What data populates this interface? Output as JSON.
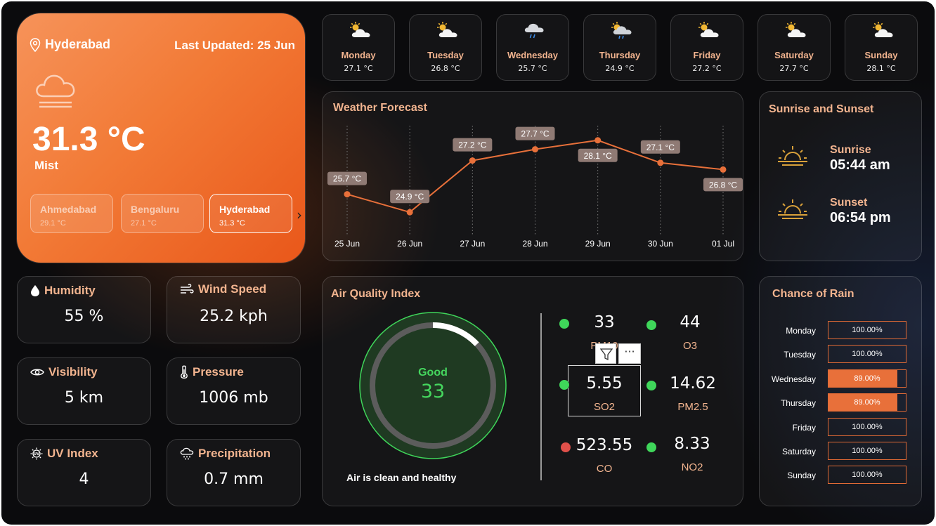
{
  "location": {
    "city": "Hyderabad",
    "last_updated": "Last Updated: 25 Jun",
    "temperature": "31.3 °C",
    "condition": "Mist",
    "icon": "cloud-mist-icon"
  },
  "cities": [
    {
      "name": "Ahmedabad",
      "temp": "29.1 °C",
      "active": false
    },
    {
      "name": "Bengaluru",
      "temp": "27.1 °C",
      "active": false
    },
    {
      "name": "Hyderabad",
      "temp": "31.3 °C",
      "active": true
    }
  ],
  "stats": {
    "humidity": {
      "label": "Humidity",
      "value": "55 %",
      "icon": "droplet-icon"
    },
    "wind": {
      "label": "Wind Speed",
      "value": "25.2 kph",
      "icon": "wind-icon"
    },
    "visibility": {
      "label": "Visibility",
      "value": "5 km",
      "icon": "eye-icon"
    },
    "pressure": {
      "label": "Pressure",
      "value": "1006 mb",
      "icon": "thermometer-icon"
    },
    "uv": {
      "label": "UV Index",
      "value": "4",
      "icon": "uv-sun-icon"
    },
    "precipitation": {
      "label": "Precipitation",
      "value": "0.7 mm",
      "icon": "rain-cloud-icon"
    }
  },
  "daily": [
    {
      "day": "Monday",
      "temp": "27.1 °C",
      "icon": "partly-cloudy-icon"
    },
    {
      "day": "Tuesday",
      "temp": "26.8 °C",
      "icon": "partly-cloudy-icon"
    },
    {
      "day": "Wednesday",
      "temp": "25.7 °C",
      "icon": "cloud-rain-icon"
    },
    {
      "day": "Thursday",
      "temp": "24.9 °C",
      "icon": "partly-cloudy-rain-icon"
    },
    {
      "day": "Friday",
      "temp": "27.2 °C",
      "icon": "partly-cloudy-icon"
    },
    {
      "day": "Saturday",
      "temp": "27.7 °C",
      "icon": "partly-cloudy-icon"
    },
    {
      "day": "Sunday",
      "temp": "28.1 °C",
      "icon": "partly-cloudy-icon"
    }
  ],
  "forecast": {
    "title": "Weather Forecast"
  },
  "chart_data": {
    "type": "line",
    "title": "Weather Forecast",
    "x": [
      "25 Jun",
      "26 Jun",
      "27 Jun",
      "28 Jun",
      "29 Jun",
      "30 Jun",
      "01 Jul"
    ],
    "series": [
      {
        "values": [
          25.7,
          24.9,
          27.2,
          27.7,
          28.1,
          27.1,
          26.8
        ],
        "labels": [
          "25.7 °C",
          "24.9 °C",
          "27.2 °C",
          "27.7 °C",
          "28.1 °C",
          "27.1 °C",
          "26.8 °C"
        ]
      }
    ],
    "ylim": [
      24.0,
      29.0
    ],
    "color": "#e8703a",
    "grid": "vertical dotted"
  },
  "sun": {
    "title": "Sunrise and Sunset",
    "sunrise_label": "Sunrise",
    "sunrise_time": "05:44 am",
    "sunset_label": "Sunset",
    "sunset_time": "06:54 pm",
    "icon_color": "#d9a13a"
  },
  "aqi": {
    "title": "Air Quality Index",
    "status": "Good",
    "value": "33",
    "level": 0.13,
    "message": "Air is clean and healthy",
    "pollutants": [
      {
        "name": "PM10",
        "value": "33",
        "color": "#3fd65a"
      },
      {
        "name": "O3",
        "value": "44",
        "color": "#3fd65a"
      },
      {
        "name": "SO2",
        "value": "5.55",
        "color": "#3fd65a"
      },
      {
        "name": "PM2.5",
        "value": "14.62",
        "color": "#3fd65a"
      },
      {
        "name": "CO",
        "value": "523.55",
        "color": "#e0504a"
      },
      {
        "name": "NO2",
        "value": "8.33",
        "color": "#3fd65a"
      }
    ]
  },
  "rain": {
    "title": "Chance of Rain",
    "rows": [
      {
        "day": "Monday",
        "pct": "100.00%",
        "fraction": 1.0
      },
      {
        "day": "Tuesday",
        "pct": "100.00%",
        "fraction": 1.0
      },
      {
        "day": "Wednesday",
        "pct": "89.00%",
        "fraction": 0.89
      },
      {
        "day": "Thursday",
        "pct": "89.00%",
        "fraction": 0.89
      },
      {
        "day": "Friday",
        "pct": "100.00%",
        "fraction": 1.0
      },
      {
        "day": "Saturday",
        "pct": "100.00%",
        "fraction": 1.0
      },
      {
        "day": "Sunday",
        "pct": "100.00%",
        "fraction": 1.0
      }
    ]
  },
  "colors": {
    "accent": "#e8703a",
    "label": "#f2b48f",
    "good": "#3fd65a",
    "bad": "#e0504a"
  }
}
